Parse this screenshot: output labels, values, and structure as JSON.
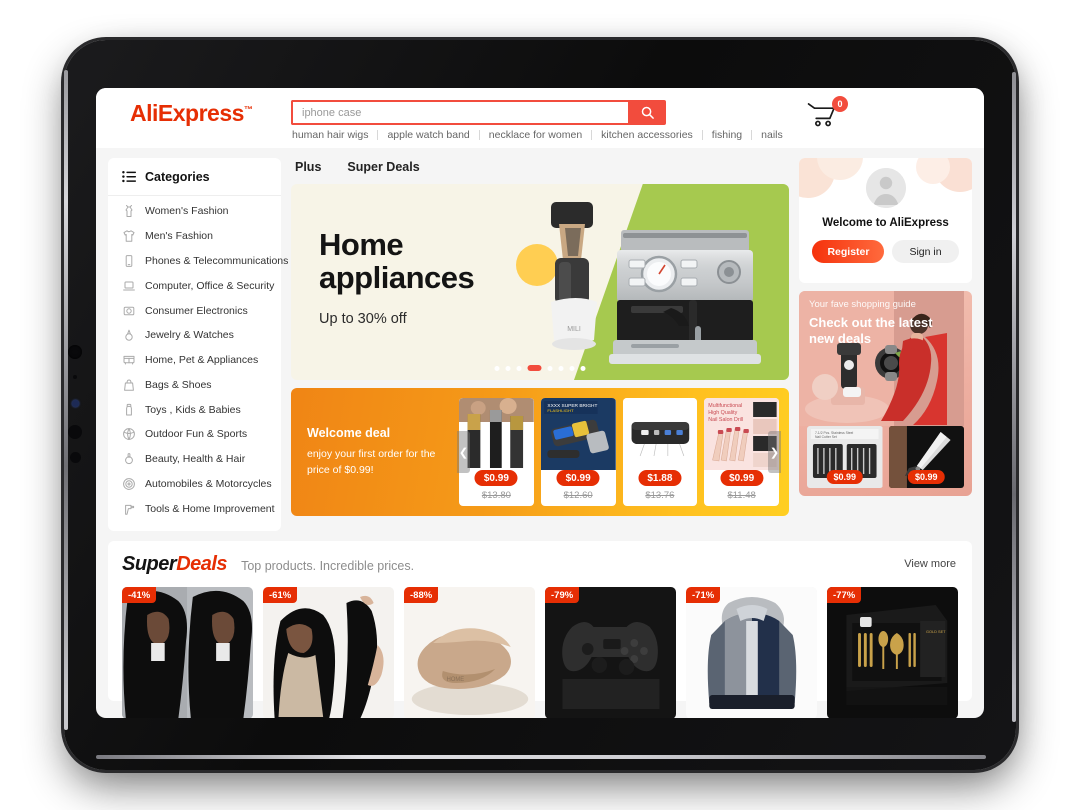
{
  "header": {
    "logo": "AliExpress",
    "logo_tm": "™",
    "search": {
      "placeholder": "iphone case",
      "value": "",
      "icon": "search-icon"
    },
    "cart": {
      "icon": "cart-icon",
      "badge": "0"
    },
    "hot_words": [
      "human hair wigs",
      "apple watch band",
      "necklace for women",
      "kitchen accessories",
      "fishing",
      "nails"
    ]
  },
  "sidebar": {
    "title": "Categories",
    "menu_icon": "list-icon",
    "items": [
      {
        "label": "Women's Fashion",
        "icon": "dress-icon"
      },
      {
        "label": "Men's Fashion",
        "icon": "tshirt-icon"
      },
      {
        "label": "Phones & Telecommunications",
        "icon": "phone-icon"
      },
      {
        "label": "Computer, Office & Security",
        "icon": "laptop-icon"
      },
      {
        "label": "Consumer Electronics",
        "icon": "camera-icon"
      },
      {
        "label": "Jewelry & Watches",
        "icon": "ring-icon"
      },
      {
        "label": "Home, Pet & Appliances",
        "icon": "sofa-icon"
      },
      {
        "label": "Bags & Shoes",
        "icon": "bag-icon"
      },
      {
        "label": "Toys , Kids & Babies",
        "icon": "bottle-icon"
      },
      {
        "label": "Outdoor Fun & Sports",
        "icon": "ball-icon"
      },
      {
        "label": "Beauty, Health & Hair",
        "icon": "perfume-icon"
      },
      {
        "label": "Automobiles & Motorcycles",
        "icon": "wheel-icon"
      },
      {
        "label": "Tools & Home Improvement",
        "icon": "drill-icon"
      }
    ]
  },
  "tabs": [
    {
      "label": "Plus"
    },
    {
      "label": "Super Deals"
    }
  ],
  "banner": {
    "title_line1": "Home",
    "title_line2": "appliances",
    "subtitle": "Up to 30% off",
    "dots_count": 8,
    "active_dot": 4,
    "accent_green": "#a6c94f",
    "accent_sun": "#ffce52",
    "background": "#f7f4e7"
  },
  "welcome_deal": {
    "title": "Welcome deal",
    "description": "enjoy your first order for the price of $0.99!",
    "prev_arrow": "chevron-left-icon",
    "next_arrow": "chevron-right-icon",
    "products": [
      {
        "price": "$0.99",
        "original_price": "$13.80",
        "alt": "hair clipper trimmer set"
      },
      {
        "price": "$0.99",
        "original_price": "$12.60",
        "alt": "super bright flashlight"
      },
      {
        "price": "$1.88",
        "original_price": "$13.76",
        "alt": "usb power bank"
      },
      {
        "price": "$0.99",
        "original_price": "$11.48",
        "alt": "nail salon drill kit"
      }
    ]
  },
  "account": {
    "title": "Welcome to AliExpress",
    "avatar_icon": "user-avatar-icon",
    "register_label": "Register",
    "signin_label": "Sign in"
  },
  "guide": {
    "kicker": "Your fave shopping guide",
    "title": "Check out the latest new deals",
    "products": [
      {
        "price": "$0.99",
        "alt": "stainless steel nail cutter set"
      },
      {
        "price": "$0.99",
        "alt": "heavy duty scissors"
      }
    ]
  },
  "super_deals": {
    "logo_part1": "Super",
    "logo_part2": "Deals",
    "tagline": "Top products. Incredible prices.",
    "view_more": "View more",
    "items": [
      {
        "discount": "-41%",
        "alt": "curly lace front wigs"
      },
      {
        "discount": "-61%",
        "alt": "straight hair bundles"
      },
      {
        "discount": "-88%",
        "alt": "beige slide sandals"
      },
      {
        "discount": "-79%",
        "alt": "wireless game controller"
      },
      {
        "discount": "-71%",
        "alt": "camo fleece hoodie jacket"
      },
      {
        "discount": "-77%",
        "alt": "gold cutlery gift set"
      }
    ]
  },
  "colors": {
    "brand_red": "#e62e04",
    "search_red": "#f24c3d",
    "deal_orange": "#f59a18",
    "banner_green": "#a6c94f"
  }
}
